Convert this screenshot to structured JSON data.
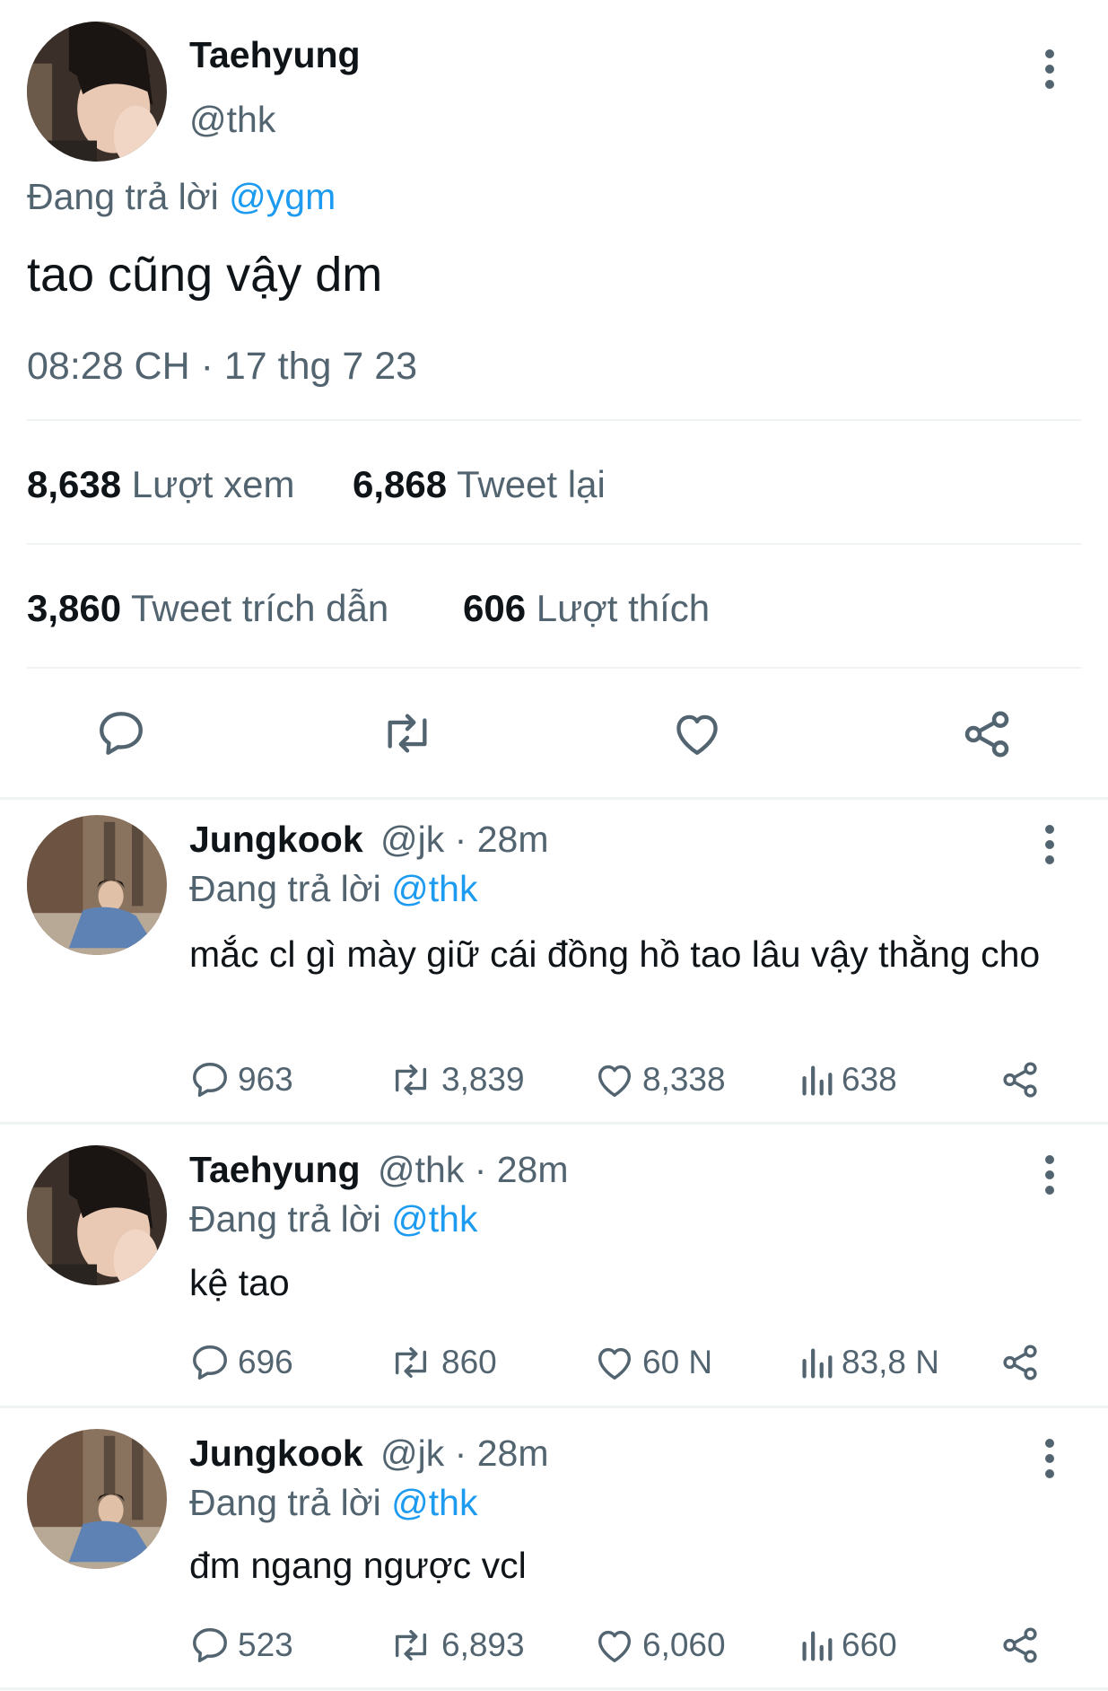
{
  "main_tweet": {
    "display_name": "Taehyung",
    "handle": "@thk",
    "replying_prefix": "Đang trả lời",
    "replying_to": "@ygm",
    "text": "tao cũng vậy dm",
    "timestamp": "08:28 CH · 17 thg 7 23",
    "stats": {
      "views_count": "8,638",
      "views_label": "Lượt xem",
      "retweets_count": "6,868",
      "retweets_label": "Tweet lại",
      "quotes_count": "3,860",
      "quotes_label": "Tweet trích dẫn",
      "likes_count": "606",
      "likes_label": "Lượt thích"
    }
  },
  "replies": [
    {
      "display_name": "Jungkook",
      "handle_time": "@jk · 28m",
      "replying_prefix": "Đang trả lời",
      "replying_to": "@thk",
      "text": "mắc cl gì mày giữ cái đồng hồ tao lâu vậy thằng cho",
      "replies": "963",
      "retweets": "3,839",
      "likes": "8,338",
      "views": "638"
    },
    {
      "display_name": "Taehyung",
      "handle_time": "@thk · 28m",
      "replying_prefix": "Đang trả lời",
      "replying_to": "@thk",
      "text": "kệ tao",
      "replies": "696",
      "retweets": "860",
      "likes": "60 N",
      "views": "83,8 N"
    },
    {
      "display_name": "Jungkook",
      "handle_time": "@jk · 28m",
      "replying_prefix": "Đang trả lời",
      "replying_to": "@thk",
      "text": "đm ngang ngược vcl",
      "replies": "523",
      "retweets": "6,893",
      "likes": "6,060",
      "views": "660"
    }
  ],
  "icons": [
    "reply-icon",
    "retweet-icon",
    "like-icon",
    "share-icon",
    "views-icon",
    "more-icon"
  ],
  "colors": {
    "link": "#1d9bf0",
    "secondary_text": "#536471",
    "divider": "#eff3f4"
  }
}
